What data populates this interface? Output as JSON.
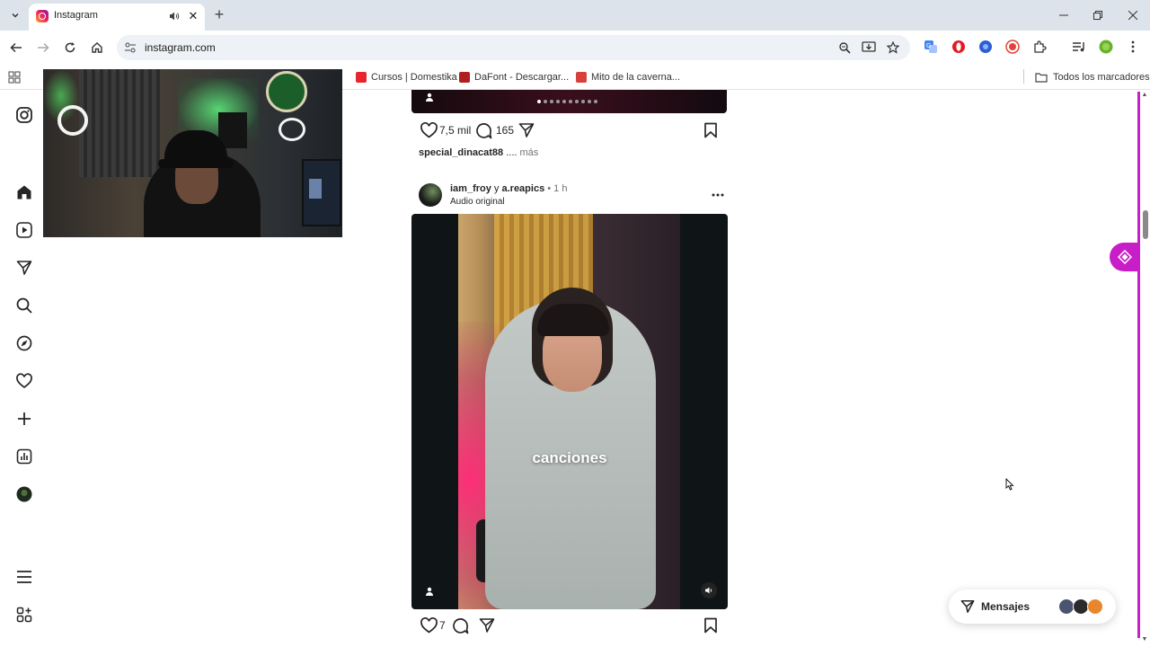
{
  "browser": {
    "tab_title": "Instagram",
    "url": "instagram.com",
    "bookmarks": [
      {
        "label": "Cursos | Domestika",
        "color": "#e5262f"
      },
      {
        "label": "DaFont - Descargar...",
        "color": "#b01e1e"
      },
      {
        "label": "Mito de la caverna...",
        "color": "#d8403a"
      }
    ],
    "all_bookmarks_label": "Todos los marcadores"
  },
  "sidebar": {
    "icons": [
      "instagram-icon",
      "home-icon",
      "reels-icon",
      "send-icon",
      "search-icon",
      "explore-icon",
      "heart-icon",
      "create-icon",
      "insights-icon",
      "profile-avatar",
      "menu-icon",
      "more-apps-icon"
    ]
  },
  "prev_post": {
    "likes": "7,5 mil",
    "comments": "165",
    "caption_user": "special_dinacat88",
    "caption_ellipsis": " ....",
    "caption_more": " más"
  },
  "post": {
    "user1": "iam_froy",
    "conj": " y ",
    "user2": "a.reapics",
    "time": " • 1 h",
    "audio": "Audio original",
    "video_caption": "canciones",
    "likes": "7"
  },
  "messages": {
    "label": "Mensajes"
  },
  "colors": {
    "accent": "#c81ec8",
    "instagram_text": "#262626",
    "muted": "#737373"
  }
}
